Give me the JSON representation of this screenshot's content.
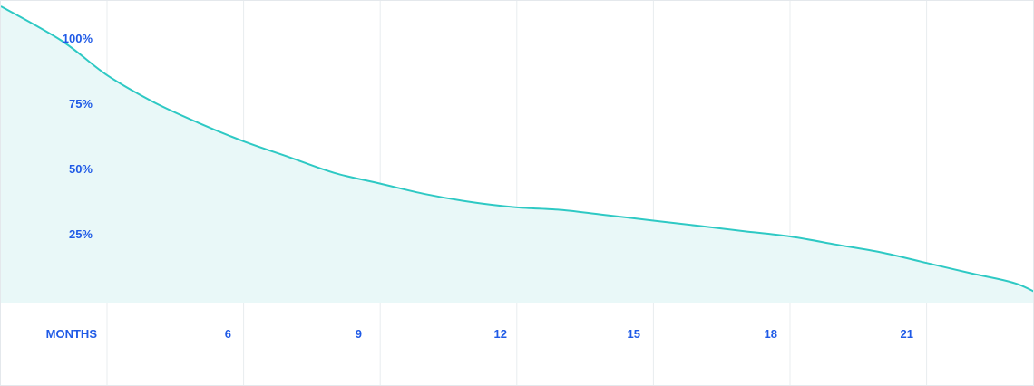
{
  "chart_data": {
    "type": "area",
    "title": "",
    "xlabel": "MONTHS",
    "ylabel": "",
    "x_tick_labels": [
      "6",
      "9",
      "12",
      "15",
      "18",
      "21"
    ],
    "y_tick_labels": [
      "100%",
      "75%",
      "50%",
      "25%"
    ],
    "xlim": [
      1.3,
      24
    ],
    "ylim": [
      0,
      100
    ],
    "grid": "vertical",
    "legend": "none",
    "series": [
      {
        "x": [
          1.3,
          2,
          3,
          4,
          5,
          6,
          7,
          8,
          9,
          10,
          11,
          12,
          13,
          14,
          15,
          16,
          17,
          18,
          19,
          20,
          21,
          22,
          23,
          23.8
        ],
        "values": [
          112,
          99,
          86,
          76,
          68,
          61,
          55,
          49,
          45,
          41,
          38,
          36,
          35,
          33,
          31,
          29,
          27,
          25,
          22,
          19,
          15,
          11,
          7,
          0
        ]
      }
    ],
    "colors": {
      "line": "#2ec9c4",
      "fill": "#e9f8f8",
      "grid": "#e8ecef",
      "tick_text": "#1f5ae6"
    }
  }
}
